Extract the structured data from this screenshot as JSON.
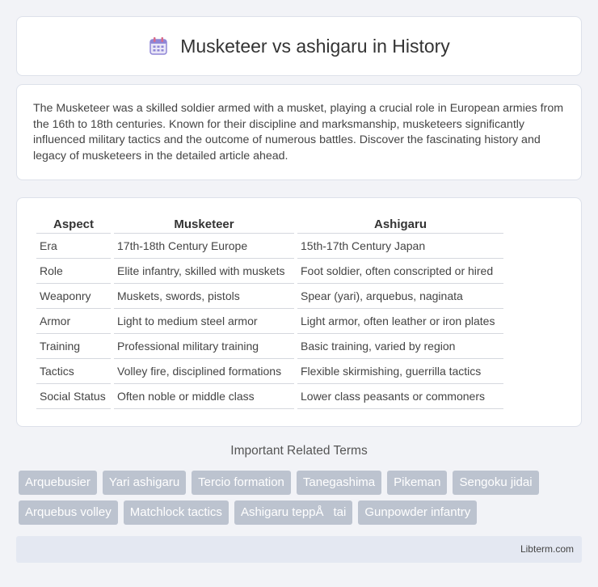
{
  "header": {
    "title": "Musketeer vs ashigaru in History",
    "icon": "calendar-icon"
  },
  "intro": {
    "text": "The Musketeer was a skilled soldier armed with a musket, playing a crucial role in European armies from the 16th to 18th centuries. Known for their discipline and marksmanship, musketeers significantly influenced military tactics and the outcome of numerous battles. Discover the fascinating history and legacy of musketeers in the detailed article ahead."
  },
  "table": {
    "headers": [
      "Aspect",
      "Musketeer",
      "Ashigaru"
    ],
    "rows": [
      [
        "Era",
        "17th-18th Century Europe",
        "15th-17th Century Japan"
      ],
      [
        "Role",
        "Elite infantry, skilled with muskets",
        "Foot soldier, often conscripted or hired"
      ],
      [
        "Weaponry",
        "Muskets, swords, pistols",
        "Spear (yari), arquebus, naginata"
      ],
      [
        "Armor",
        "Light to medium steel armor",
        "Light armor, often leather or iron plates"
      ],
      [
        "Training",
        "Professional military training",
        "Basic training, varied by region"
      ],
      [
        "Tactics",
        "Volley fire, disciplined formations",
        "Flexible skirmishing, guerrilla tactics"
      ],
      [
        "Social Status",
        "Often noble or middle class",
        "Lower class peasants or commoners"
      ]
    ]
  },
  "terms": {
    "heading": "Important Related Terms",
    "items": [
      "Arquebusier",
      "Yari ashigaru",
      "Tercio formation",
      "Tanegashima",
      "Pikeman",
      "Sengoku jidai",
      "Arquebus volley",
      "Matchlock tactics",
      "Ashigaru teppÅtai",
      "Gunpowder infantry"
    ]
  },
  "footer": {
    "text": "Libterm.com"
  }
}
